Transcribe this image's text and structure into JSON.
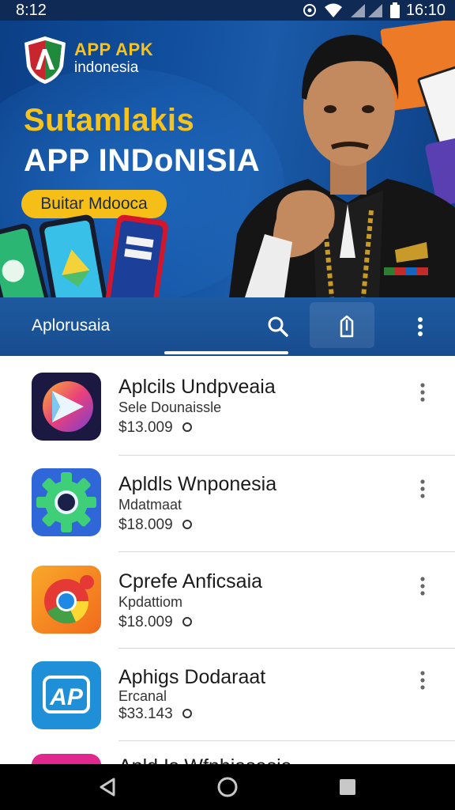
{
  "status_bar": {
    "time_left": "8:12",
    "time_right": "16:10"
  },
  "banner": {
    "logo_title": "APP APK",
    "logo_subtitle": "indonesia",
    "title_line1": "Sutamlakis",
    "title_line2": "APP INDoNISIA",
    "cta_label": "Buitar Mdooca"
  },
  "app_bar": {
    "title": "Aplorusaia"
  },
  "apps": [
    {
      "name": "Aplcils Undpveaia",
      "subtitle": "Sele Dounaissle",
      "price": "$13.009",
      "icon": "play-store-icon"
    },
    {
      "name": "Apldls Wnponesia",
      "subtitle": "Mdatmaat",
      "price": "$18.009",
      "icon": "settings-gear-icon"
    },
    {
      "name": "Cprefe Anficsaia",
      "subtitle": "Kpdattiom",
      "price": "$18.009",
      "icon": "chrome-icon"
    },
    {
      "name": "Aphigs Dodaraat",
      "subtitle": "Ercanal",
      "price": "$33.143",
      "icon": "ap-icon"
    },
    {
      "name": "Apld Is Wfnhiasasia",
      "subtitle": "",
      "price": "",
      "icon": "pink-app-icon"
    }
  ],
  "colors": {
    "hero_blue": "#114f9e",
    "accent_yellow": "#f6bf17",
    "app_bar_blue": "#1e5aa0"
  }
}
